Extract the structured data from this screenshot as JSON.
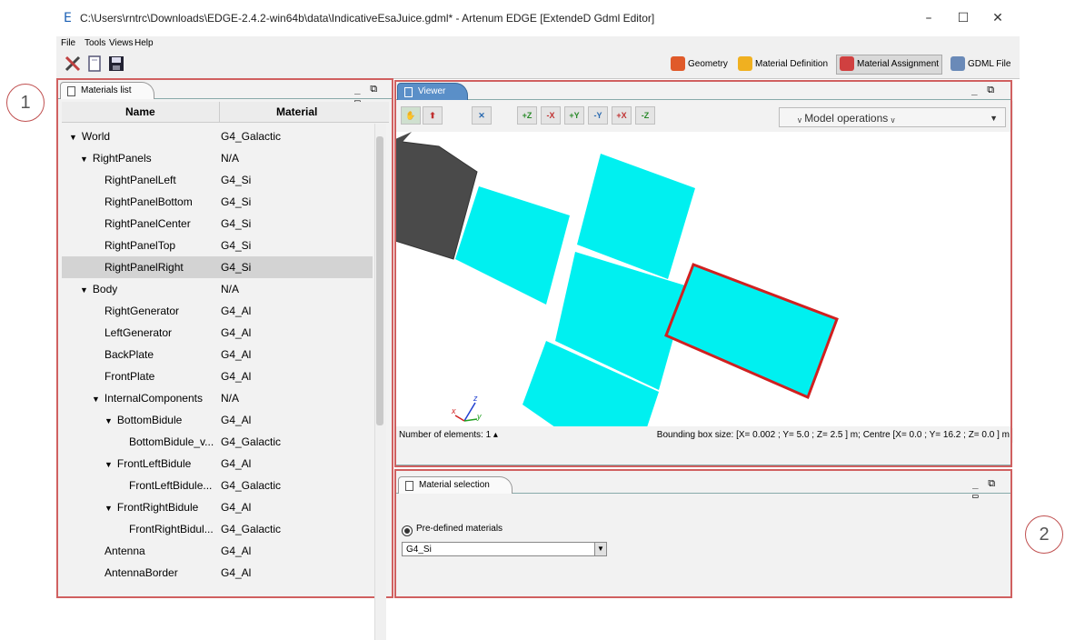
{
  "window": {
    "title": "C:\\Users\\rntrc\\Downloads\\EDGE-2.4.2-win64b\\data\\IndicativeEsaJuice.gdml* - Artenum EDGE [ExtendeD Gdml Editor]",
    "logo": "E",
    "minimize": "–",
    "maximize": "☐",
    "close": "✕"
  },
  "menu": [
    "File",
    "Tools",
    "Views",
    "Help"
  ],
  "perspectives": [
    {
      "label": "Geometry",
      "color": "#e05a2a"
    },
    {
      "label": "Material Definition",
      "color": "#f0b020"
    },
    {
      "label": "Material Assignment",
      "color": "#d04040"
    },
    {
      "label": "GDML File",
      "color": "#6a8ab8"
    }
  ],
  "callouts": [
    "1",
    "2"
  ],
  "materials_panel": {
    "tab": "Materials list",
    "col_name": "Name",
    "col_material": "Material",
    "rows": [
      {
        "name": "World",
        "material": "G4_Galactic"
      },
      {
        "name": "RightPanels",
        "material": "N/A"
      },
      {
        "name": "RightPanelLeft",
        "material": "G4_Si"
      },
      {
        "name": "RightPanelBottom",
        "material": "G4_Si"
      },
      {
        "name": "RightPanelCenter",
        "material": "G4_Si"
      },
      {
        "name": "RightPanelTop",
        "material": "G4_Si"
      },
      {
        "name": "RightPanelRight",
        "material": "G4_Si"
      },
      {
        "name": "Body",
        "material": "N/A"
      },
      {
        "name": "RightGenerator",
        "material": "G4_Al"
      },
      {
        "name": "LeftGenerator",
        "material": "G4_Al"
      },
      {
        "name": "BackPlate",
        "material": "G4_Al"
      },
      {
        "name": "FrontPlate",
        "material": "G4_Al"
      },
      {
        "name": "InternalComponents",
        "material": "N/A"
      },
      {
        "name": "BottomBidule",
        "material": "G4_Al"
      },
      {
        "name": "BottomBidule_v...",
        "material": "G4_Galactic"
      },
      {
        "name": "FrontLeftBidule",
        "material": "G4_Al"
      },
      {
        "name": "FrontLeftBidule...",
        "material": "G4_Galactic"
      },
      {
        "name": "FrontRightBidule",
        "material": "G4_Al"
      },
      {
        "name": "FrontRightBidul...",
        "material": "G4_Galactic"
      },
      {
        "name": "Antenna",
        "material": "G4_Al"
      },
      {
        "name": "AntennaBorder",
        "material": "G4_Al"
      }
    ]
  },
  "viewer": {
    "tab": "Viewer",
    "model_ops": "ᵥ Model operations ᵥ",
    "buttons": [
      "✋",
      "⬆",
      "✕",
      "+Z",
      "-X",
      "+Y",
      "-Y",
      "+X",
      "-Z"
    ],
    "status_left": "Number of elements:  1 ▴",
    "status_right": "Bounding box size: [X= 0.002 ; Y= 5.0 ; Z= 2.5 ] m;  Centre [X= 0.0 ; Y= 16.2 ; Z= 0.0 ] m",
    "axes": {
      "x": "x",
      "y": "y",
      "z": "z"
    }
  },
  "material_selection": {
    "tab": "Material selection",
    "radio_label": "Pre-defined materials",
    "selected": "G4_Si"
  }
}
